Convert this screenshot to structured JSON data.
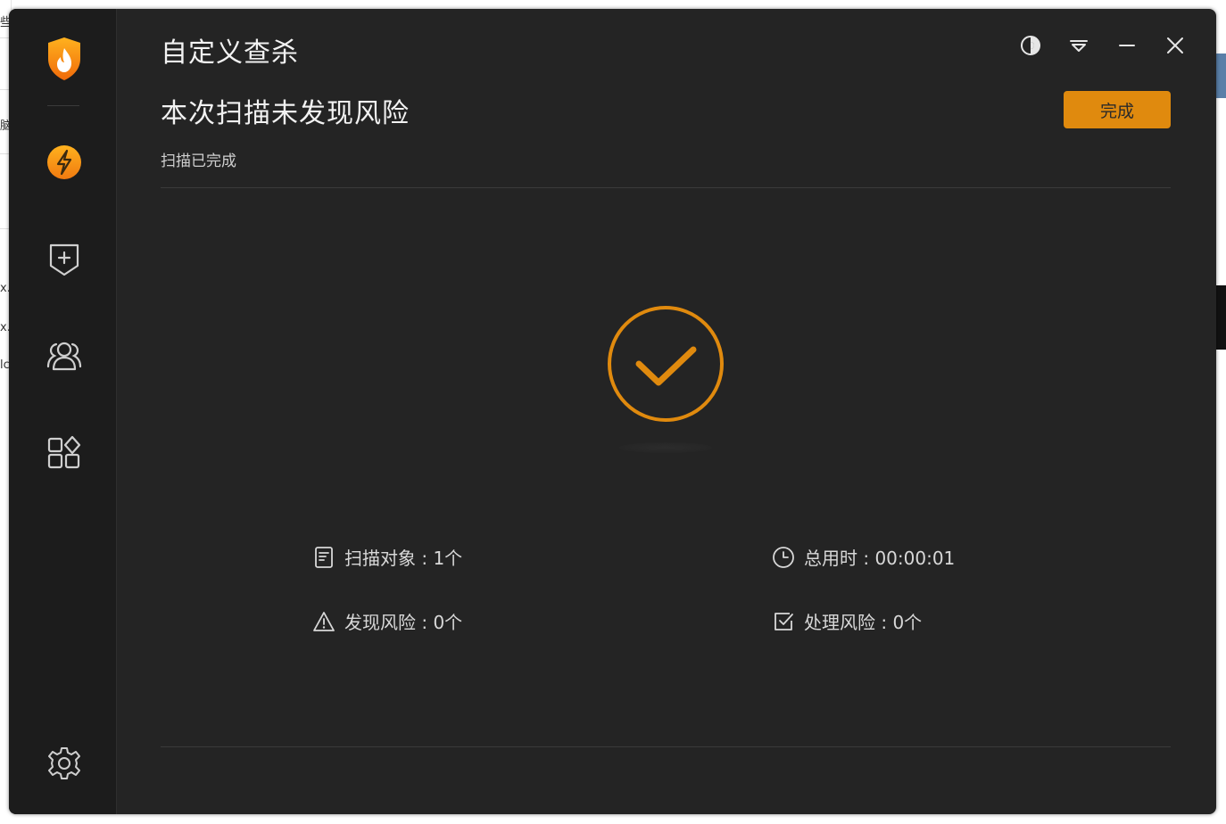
{
  "window": {
    "title": "自定义查杀"
  },
  "result": {
    "heading": "本次扫描未发现风险",
    "status": "扫描已完成",
    "done_button": "完成"
  },
  "stats": {
    "scan_objects": "扫描对象 : 1个",
    "found_risks": "发现风险 : 0个",
    "total_time": "总用时 : 00:00:01",
    "handled_risks": "处理风险 : 0个"
  },
  "sidebar": {
    "items": [
      {
        "icon": "lightning-icon"
      },
      {
        "icon": "shield-plus-icon"
      },
      {
        "icon": "users-icon"
      },
      {
        "icon": "apps-icon"
      },
      {
        "icon": "gear-icon"
      }
    ]
  },
  "colors": {
    "accent": "#e08a0e",
    "background": "#242424",
    "sidebar": "#1c1c1c"
  },
  "background_fragments": {
    "left_glyphs": [
      "些",
      "脑",
      "x.",
      "x.",
      "lc"
    ]
  }
}
